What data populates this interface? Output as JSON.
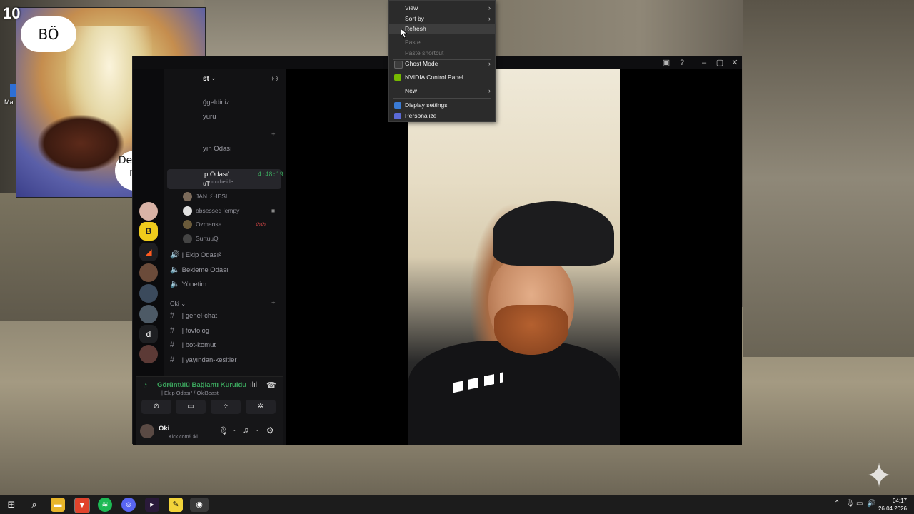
{
  "meme": {
    "counter": "10",
    "bubble_top": "BÖ",
    "bubble_bottom_line1": "Dede korkuttun",
    "bubble_bottom_line2": "napıyon aq"
  },
  "desktop": {
    "icon_label": "Ma"
  },
  "context_menu": {
    "items": [
      {
        "label": "View",
        "submenu": true
      },
      {
        "label": "Sort by",
        "submenu": true
      },
      {
        "label": "Refresh",
        "hover": true
      },
      {
        "label": "Paste",
        "disabled": true
      },
      {
        "label": "Paste shortcut",
        "disabled": true
      },
      {
        "label": "Ghost Mode",
        "submenu": true
      },
      {
        "label": "NVIDIA Control Panel"
      },
      {
        "label": "New",
        "submenu": true
      },
      {
        "label": "Display settings"
      },
      {
        "label": "Personalize"
      }
    ]
  },
  "discord": {
    "server_name_fragment": "st",
    "channels": [
      {
        "label": "ğgeldiniz"
      },
      {
        "label": "yuru"
      },
      {
        "label": "yın Odası"
      },
      {
        "label": "p Odası'",
        "timer": "4:48:19",
        "subtitle": "rumu belirle"
      },
      {
        "label": "uT"
      }
    ],
    "members": [
      {
        "name": "JAN ⚡HESI"
      },
      {
        "name": "obsessed lempy"
      },
      {
        "name": "Ozmanse"
      },
      {
        "name": "SurtuuQ"
      }
    ],
    "voice_channels": [
      {
        "label": "| Ekip Odası²"
      },
      {
        "label": "Bekleme Odası"
      },
      {
        "label": "Yönetim"
      }
    ],
    "category": "Oki",
    "text_channels": [
      {
        "label": "| genel-chat"
      },
      {
        "label": "| fovtolog"
      },
      {
        "label": "| bot-komut"
      },
      {
        "label": "| yayından-kesitler"
      }
    ],
    "rail_letter": "d",
    "voice_status": "Görüntülü Bağlantı Kuruldu",
    "voice_sub": "| Ekip Odası² / OkiBeast",
    "user_name": "Oki",
    "user_status": "Kick.com/Oki..."
  },
  "taskbar": {
    "time": "04:17",
    "date": "26.04.2026"
  }
}
